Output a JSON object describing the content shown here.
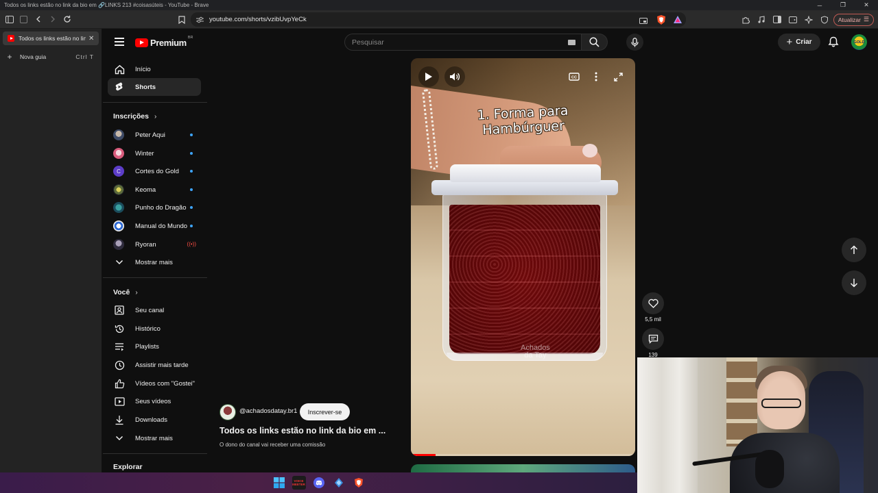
{
  "window": {
    "title": "Todos os links estão no link da bio em 🔗LINKS 213 #coisasúteis - YouTube - Brave"
  },
  "browser": {
    "url": "youtube.com/shorts/vzibUvpYeCk",
    "update_label": "Atualizar",
    "tabs": [
      {
        "label": "Todos os links estão no link da bio em"
      }
    ],
    "new_tab": {
      "label": "Nova guia",
      "shortcut": "Ctrl T"
    }
  },
  "youtube": {
    "logo_text": "Premium",
    "logo_region": "BR",
    "search_placeholder": "Pesquisar",
    "create_label": "Criar",
    "avatar_text": "GOLD"
  },
  "sidebar": {
    "main": [
      {
        "label": "Início",
        "icon": "home-icon"
      },
      {
        "label": "Shorts",
        "icon": "shorts-icon",
        "active": true
      }
    ],
    "subscriptions_heading": "Inscrições",
    "subscriptions": [
      {
        "label": "Peter Aqui",
        "status": "new"
      },
      {
        "label": "Winter",
        "status": "new"
      },
      {
        "label": "Cortes do Gold",
        "status": "new",
        "initial": "C"
      },
      {
        "label": "Keoma",
        "status": "new"
      },
      {
        "label": "Punho do Dragão",
        "status": "new"
      },
      {
        "label": "Manual do Mundo",
        "status": "new"
      },
      {
        "label": "Ryoran",
        "status": "live"
      }
    ],
    "show_more_1": "Mostrar mais",
    "you_heading": "Você",
    "you": [
      {
        "label": "Seu canal",
        "icon": "channel-icon"
      },
      {
        "label": "Histórico",
        "icon": "history-icon"
      },
      {
        "label": "Playlists",
        "icon": "playlists-icon"
      },
      {
        "label": "Assistir mais tarde",
        "icon": "watch-later-icon"
      },
      {
        "label": "Vídeos com \"Gostei\"",
        "icon": "liked-icon"
      },
      {
        "label": "Seus vídeos",
        "icon": "your-videos-icon"
      },
      {
        "label": "Downloads",
        "icon": "downloads-icon"
      }
    ],
    "show_more_2": "Mostrar mais",
    "explore_heading": "Explorar"
  },
  "short": {
    "caption_line1": "1. Forma para",
    "caption_line2": "Hambúrguer",
    "watermark_line1": "Achados",
    "watermark_line2": "da Tay",
    "progress": 0.11,
    "channel": "@achadosdatay.br1",
    "subscribe_label": "Inscrever-se",
    "title": "Todos os links estão no link da bio em ...",
    "subtitle": "O dono do canal vai receber uma comissão",
    "likes": "5,5 mil",
    "comments": "139"
  },
  "taskbar": {
    "apps": [
      "windows-start-icon",
      "voicemeeter-icon",
      "discord-icon",
      "app-icon",
      "brave-icon"
    ],
    "voicemeeter_text": "VOICE MEETER"
  }
}
